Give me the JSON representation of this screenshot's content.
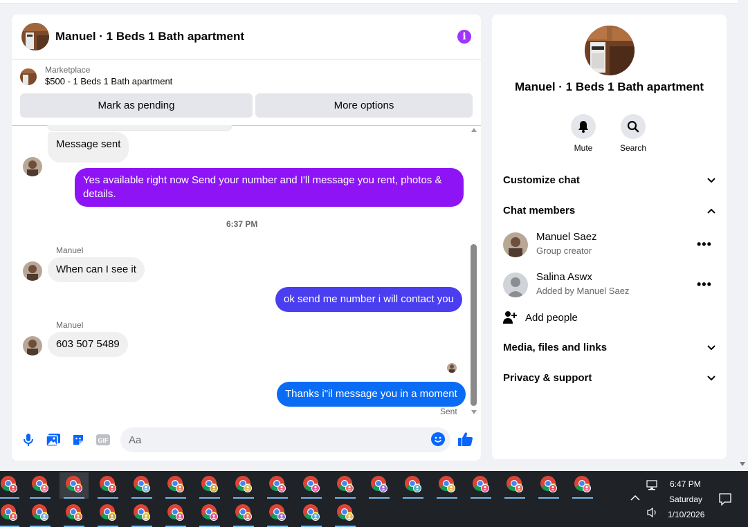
{
  "conversation": {
    "title": "Manuel · 1 Beds 1 Bath apartment",
    "info_icon": "info-icon"
  },
  "marketplace": {
    "label": "Marketplace",
    "item": "$500 - 1 Beds 1 Bath apartment",
    "mark_pending": "Mark as pending",
    "more_options": "More options"
  },
  "messages": {
    "m1_text": "Message sent",
    "m2_text": "Yes available right now Send your number and I'll message you rent, photos & details.",
    "timestamp": "6:37 PM",
    "m3_sender": "Manuel",
    "m3_text": "When can I see it",
    "m4_text": "ok send me number i will contact you",
    "m5_sender": "Manuel",
    "m5_text": "603 507 5489",
    "m6_text": "Thanks i\"il message you in a moment",
    "status": "Sent"
  },
  "composer": {
    "placeholder": "Aa"
  },
  "sidebar": {
    "title": "Manuel · 1 Beds 1 Bath apartment",
    "mute_label": "Mute",
    "search_label": "Search",
    "customize_chat": "Customize chat",
    "chat_members": "Chat members",
    "members": [
      {
        "name": "Manuel Saez",
        "role": "Group creator"
      },
      {
        "name": "Salina Aswx",
        "role": "Added by Manuel Saez"
      }
    ],
    "add_people": "Add people",
    "media_files_links": "Media, files and links",
    "privacy_support": "Privacy & support"
  },
  "taskbar": {
    "time": "6:47 PM",
    "day": "Saturday",
    "date": "1/10/2026"
  },
  "colors": {
    "purple_bubble": "#8e14f5",
    "indigo_bubble": "#4a3ef0",
    "blue_bubble": "#0a6cf5",
    "messenger_blue": "#0866ff",
    "info_purple": "#a033ff"
  }
}
